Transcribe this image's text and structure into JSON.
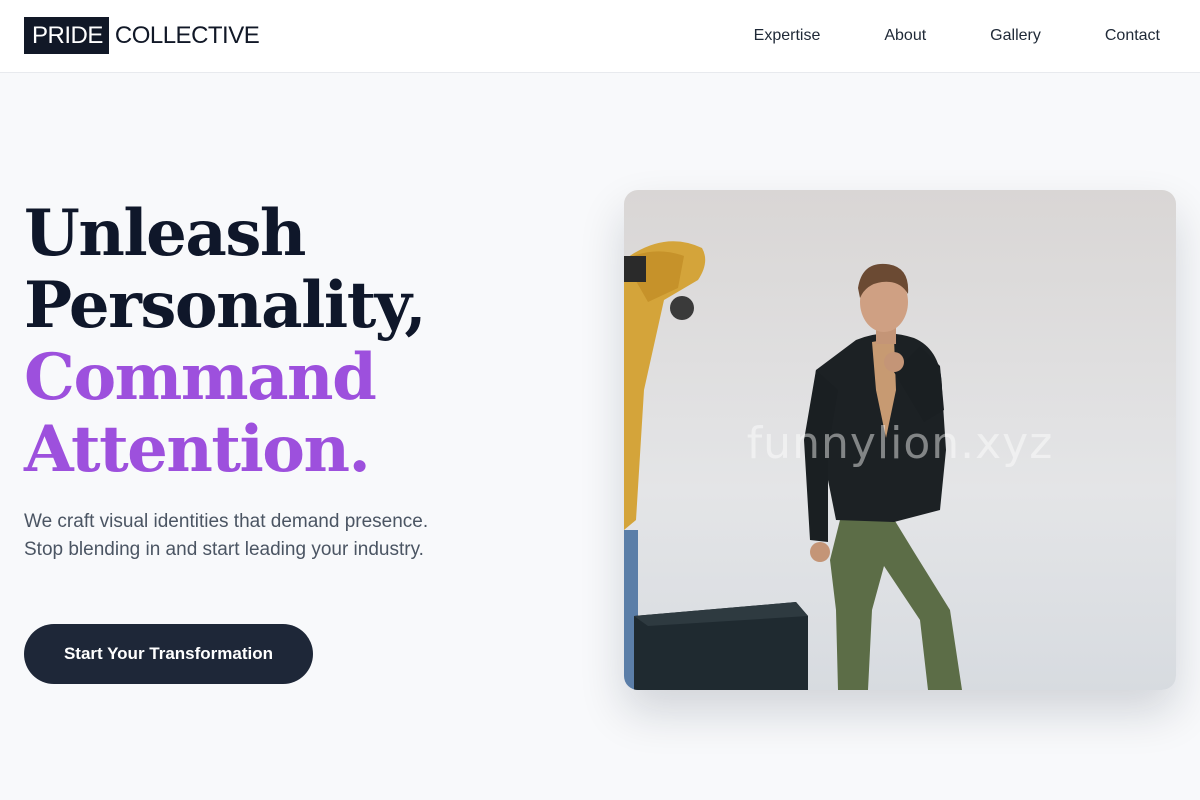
{
  "brand": {
    "box_text": "PRIDE",
    "text": "COLLECTIVE"
  },
  "nav": {
    "items": [
      {
        "label": "Expertise"
      },
      {
        "label": "About"
      },
      {
        "label": "Gallery"
      },
      {
        "label": "Contact"
      }
    ]
  },
  "hero": {
    "title_lines": [
      "Unleash",
      "Personality,"
    ],
    "accent_lines": [
      "Command",
      "Attention."
    ],
    "subtitle": "We craft visual identities that demand presence. Stop blending in and start leading your industry.",
    "cta_label": "Start Your Transformation",
    "image": {
      "watermark": "funnylion.xyz",
      "subject": "photo of a man in a black blazer and olive pants being photographed in a studio"
    }
  },
  "colors": {
    "accent": "#9d50dd",
    "heading": "#0f172a",
    "button_bg": "#1e2738",
    "page_bg": "#f8f9fb"
  }
}
